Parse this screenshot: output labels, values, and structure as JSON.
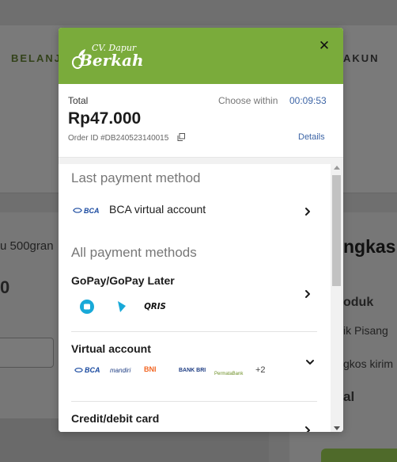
{
  "background": {
    "nav_left": "BELANJ",
    "nav_right": "AKUN",
    "product_text": "u 500gran",
    "price_text": "0",
    "side_title": "ngkas",
    "side_label_1": "oduk",
    "side_item_1": "ik Pisang",
    "side_item_2": "gkos kirim",
    "side_total": "al"
  },
  "modal": {
    "brand_line1": "CV. Dapur",
    "brand_line2": "Berkah",
    "close_symbol": "✕",
    "total_label": "Total",
    "total_amount": "Rp47.000",
    "order_id": "Order ID #DB240523140015",
    "choose_within_label": "Choose within",
    "countdown": "00:09:53",
    "details_link": "Details",
    "last_method_title": "Last payment method",
    "last_method": {
      "bank": "BCA",
      "label": "BCA virtual account"
    },
    "all_methods_title": "All payment methods",
    "methods": [
      {
        "label": "GoPay/GoPay Later",
        "logos": [
          "gopay",
          "gopay later",
          "QRIS"
        ]
      },
      {
        "label": "Virtual account",
        "logos": [
          "BCA",
          "mandiri",
          "BNI",
          "BANK BRI",
          "PermataBank"
        ],
        "more": "+2"
      },
      {
        "label": "Credit/debit card"
      }
    ]
  },
  "colors": {
    "header_green": "#7aab3b",
    "link_blue": "#3d65a6"
  }
}
